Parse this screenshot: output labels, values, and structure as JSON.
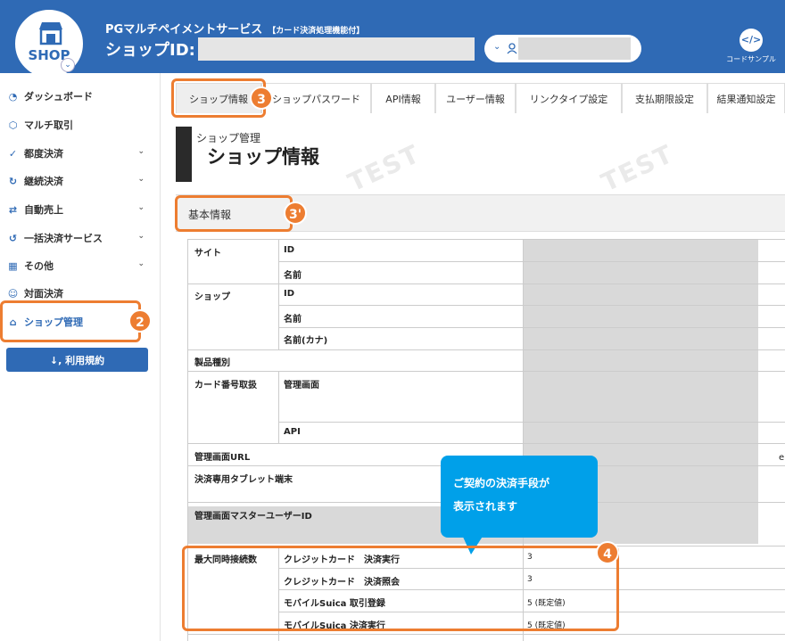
{
  "header": {
    "logo_text": "SHOP",
    "service_title": "PGマルチペイメントサービス",
    "service_subtitle": "【カード決済処理機能付】",
    "shop_id_label": "ショップID:",
    "code_sample_label": "コードサンプル",
    "code_icon_glyph": "</>"
  },
  "sidebar": {
    "items": [
      {
        "label": "ダッシュボード",
        "icon": "dashboard-icon",
        "chevron": false
      },
      {
        "label": "マルチ取引",
        "icon": "cube-icon",
        "chevron": false
      },
      {
        "label": "都度決済",
        "icon": "check-circle-icon",
        "chevron": true
      },
      {
        "label": "継続決済",
        "icon": "repeat-icon",
        "chevron": true
      },
      {
        "label": "自動売上",
        "icon": "auto-icon",
        "chevron": true
      },
      {
        "label": "一括決済サービス",
        "icon": "batch-icon",
        "chevron": true
      },
      {
        "label": "その他",
        "icon": "grid-icon",
        "chevron": true
      },
      {
        "label": "対面決済",
        "icon": "face-icon",
        "chevron": false
      },
      {
        "label": "ショップ管理",
        "icon": "store-icon",
        "chevron": false
      }
    ],
    "terms_button": "↓, 利用規約"
  },
  "tabs": [
    "ショップ情報",
    "ショップパスワード",
    "API情報",
    "ユーザー情報",
    "リンクタイプ設定",
    "支払期限設定",
    "結果通知設定"
  ],
  "page": {
    "breadcrumb": "ショップ管理",
    "title": "ショップ情報",
    "watermark": "TEST",
    "section_title": "基本情報"
  },
  "table": {
    "site": "サイト",
    "id": "ID",
    "name": "名前",
    "shop": "ショップ",
    "name_kana": "名前(カナ)",
    "product_type": "製品種別",
    "card_handling": "カード番号取扱",
    "admin_screen": "管理画面",
    "api": "API",
    "admin_url": "管理画面URL",
    "url_tail": "e",
    "tablet": "決済専用タブレット端末",
    "master_user_id": "管理画面マスターユーザーID",
    "max_connections": "最大同時接続数",
    "conn_rows": [
      {
        "label": "クレジットカード　決済実行",
        "value": "3"
      },
      {
        "label": "クレジットカード　決済照会",
        "value": "3"
      },
      {
        "label": "モバイルSuica 取引登録",
        "value": "5 (既定値)"
      },
      {
        "label": "モバイルSuica 決済実行",
        "value": "5 (既定値)"
      }
    ]
  },
  "callout": {
    "line1": "ご契約の決済手段が",
    "line2": "表示されます"
  },
  "badges": {
    "tab": "3",
    "section": "3'",
    "sidebar": "2",
    "connections": "4"
  },
  "colors": {
    "header_blue": "#2f6ab5",
    "highlight_orange": "#ed7d31",
    "callout_blue": "#00a0e9"
  }
}
